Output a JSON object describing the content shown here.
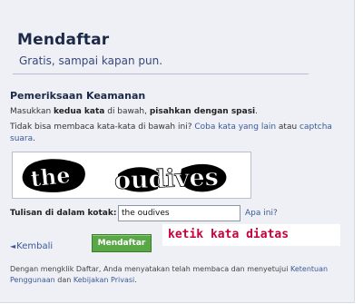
{
  "header": {
    "title": "Mendaftar",
    "subtitle": "Gratis, sampai kapan pun."
  },
  "security": {
    "heading": "Pemeriksaan Keamanan",
    "instruction": {
      "prefix": "Masukkan ",
      "bold1": "kedua kata",
      "middle": " di bawah, ",
      "bold2": "pisahkan dengan spasi",
      "suffix": "."
    },
    "cant_read": {
      "text": "Tidak bisa membaca kata-kata di bawah ini? ",
      "link1": "Coba kata yang lain",
      "joiner": " atau ",
      "link2": "captcha suara",
      "end": "."
    },
    "captcha_words": [
      "the",
      "oudives"
    ]
  },
  "form": {
    "field_label": "Tulisan di dalam kotak:",
    "field_value": "the oudives",
    "whats_this": "Apa ini?"
  },
  "actions": {
    "back_arrow": "◄",
    "back_label": "Kembali",
    "submit_label": "Mendaftar"
  },
  "annotation": "ketik kata diatas",
  "terms": {
    "prefix": "Dengan mengklik Daftar, Anda menyatakan telah membaca dan menyetujui ",
    "link1": "Ketentuan Penggunaan",
    "joiner": " dan ",
    "link2": "Kebijakan Privasi",
    "end": "."
  },
  "colors": {
    "background": "#eef0f5",
    "link": "#3b5998",
    "button": "#59a747",
    "annotation_text": "#c8003c"
  }
}
